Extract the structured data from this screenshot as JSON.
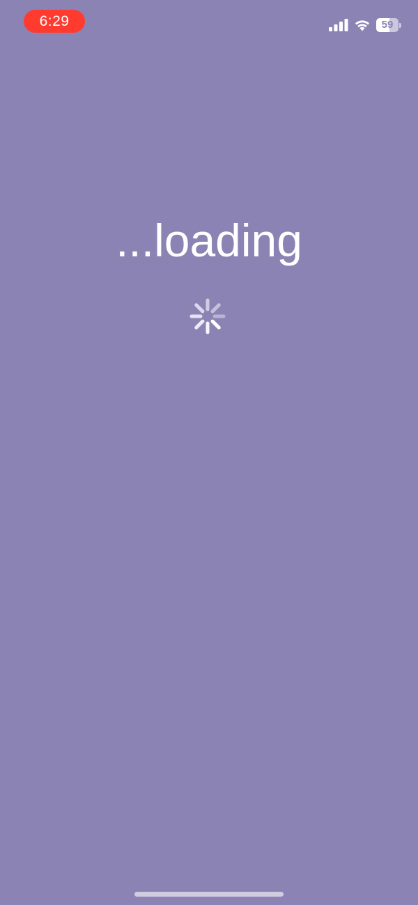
{
  "status_bar": {
    "time": "6:29",
    "time_pill_color": "#ff3b30",
    "battery_level": "59",
    "battery_fraction": 0.59,
    "icons": [
      "cellular-signal-icon",
      "wifi-icon",
      "battery-icon"
    ]
  },
  "main": {
    "loading_label": "...loading",
    "spinner_icon": "activity-spinner-icon"
  },
  "colors": {
    "background": "#8c83b5",
    "text": "#ffffff"
  }
}
